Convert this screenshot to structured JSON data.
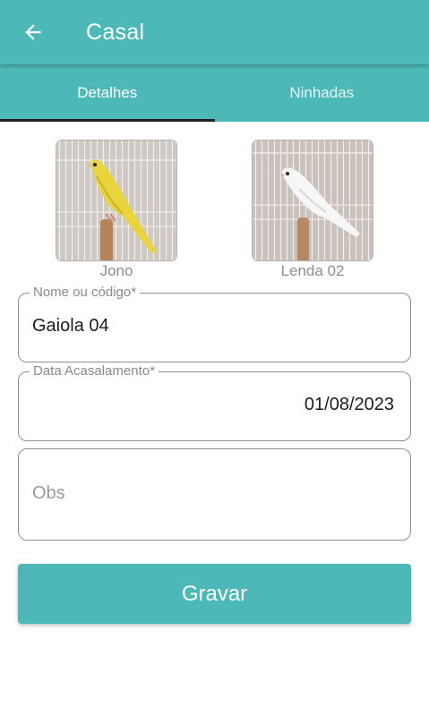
{
  "colors": {
    "primary": "#4db8b8",
    "tab_indicator": "#1f1f1f"
  },
  "appbar": {
    "title": "Casal",
    "back_icon": "arrow-left-icon"
  },
  "tabs": [
    {
      "label": "Detalhes",
      "active": true
    },
    {
      "label": "Ninhadas",
      "active": false
    }
  ],
  "birds": [
    {
      "name": "Jono",
      "image": "yellow-canary-photo"
    },
    {
      "name": "Lenda 02",
      "image": "white-canary-photo"
    }
  ],
  "form": {
    "name_field": {
      "label": "Nome ou código*",
      "value": "Gaiola 04"
    },
    "date_field": {
      "label": "Data Acasalamento*",
      "value": "01/08/2023"
    },
    "obs_field": {
      "placeholder": "Obs",
      "value": ""
    }
  },
  "save_button": {
    "label": "Gravar"
  }
}
